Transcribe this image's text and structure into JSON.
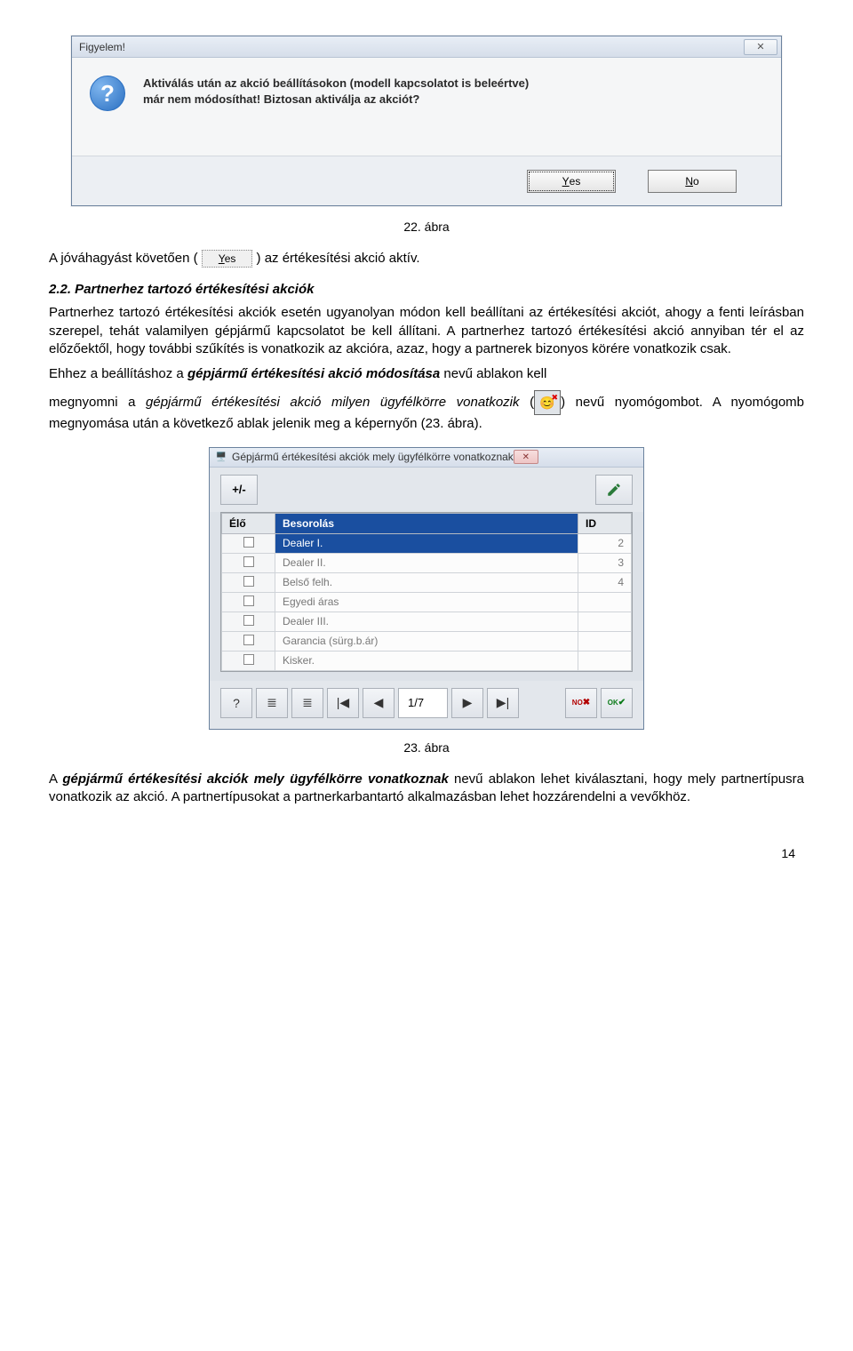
{
  "dialog1": {
    "title": "Figyelem!",
    "icon_char": "?",
    "body_line1": "Aktiválás után az akció beállításokon (modell kapcsolatot is beleértve)",
    "body_line2": "már nem módosíthat! Biztosan aktiválja az akciót?",
    "yes_label": "Yes",
    "no_label": "No",
    "close_char": "✕"
  },
  "captions": {
    "fig22": "22. ábra",
    "fig23": "23. ábra"
  },
  "inlineYes": "Yes",
  "text": {
    "p1_before": "A jóváhagyást követően (",
    "p1_after": ") az értékesítési akció aktív.",
    "h22": "2.2. Partnerhez tartozó értékesítési akciók",
    "p2": "Partnerhez tartozó értékesítési akciók esetén ugyanolyan módon kell beállítani az értékesítési akciót, ahogy a fenti leírásban szerepel, tehát valamilyen gépjármű kapcsolatot be kell állítani. A partnerhez tartozó értékesítési akció annyiban tér el az előzőektől, hogy további szűkítés is vonatkozik az akcióra, azaz, hogy a partnerek bizonyos körére vonatkozik csak.",
    "p3_a": "Ehhez a beállításhoz a ",
    "p3_b": "gépjármű értékesítési akció módosítása",
    "p3_c": " nevű ablakon kell",
    "p4_a": "megnyomni a ",
    "p4_b": "gépjármű értékesítési akció milyen ügyfélkörre vonatkozik",
    "p4_c": " (",
    "p4_d": ") nevű nyomógombot. A nyomógomb megnyomása után a következő ablak jelenik meg a képernyőn (23. ábra).",
    "p5_a": "A ",
    "p5_b": "gépjármű értékesítési akciók mely ügyfélkörre vonatkoznak",
    "p5_c": " nevű ablakon lehet kiválasztani, hogy mely partnertípusra vonatkozik az akció. A partnertípusokat a partnerkarbantartó alkalmazásban lehet hozzárendelni a vevőkhöz."
  },
  "dialog2": {
    "title": "Gépjármű értékesítési akciók mely ügyfélkörre vonatkoznak",
    "plusminus": "+/-",
    "cols": {
      "elo": "Élő",
      "besorolas": "Besorolás",
      "id": "ID"
    },
    "rows": [
      {
        "name": "Dealer I.",
        "id": "2",
        "sel": true
      },
      {
        "name": "Dealer II.",
        "id": "3"
      },
      {
        "name": "Belső felh.",
        "id": "4"
      },
      {
        "name": "Egyedi áras",
        "id": ""
      },
      {
        "name": "Dealer III.",
        "id": ""
      },
      {
        "name": "Garancia (sürg.b.ár)",
        "id": ""
      },
      {
        "name": "Kisker.",
        "id": ""
      }
    ],
    "counter": "1/7",
    "no": "NO",
    "ok": "OK"
  },
  "pagenum": "14"
}
